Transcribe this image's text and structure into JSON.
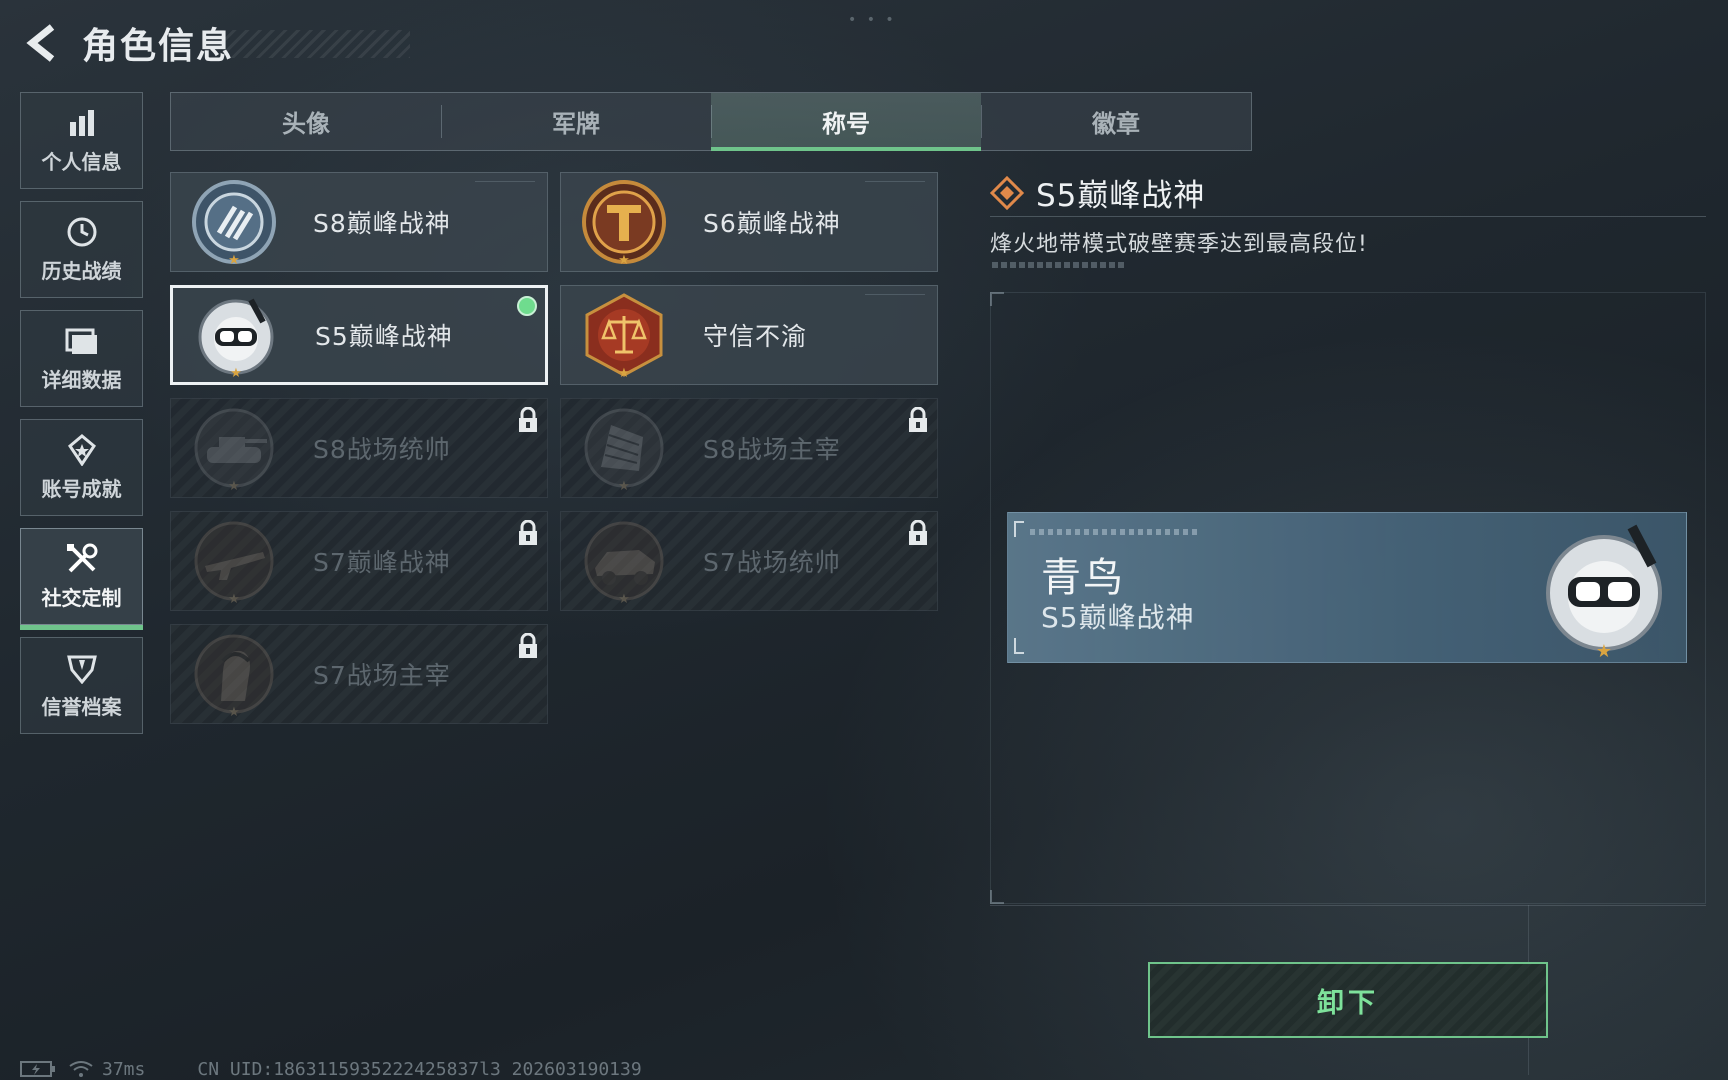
{
  "header": {
    "title": "角色信息"
  },
  "sidebar": {
    "items": [
      {
        "label": "个人信息",
        "icon": "bar-chart-icon",
        "active": false
      },
      {
        "label": "历史战绩",
        "icon": "history-icon",
        "active": false
      },
      {
        "label": "详细数据",
        "icon": "folder-icon",
        "active": false
      },
      {
        "label": "账号成就",
        "icon": "achievement-icon",
        "active": false
      },
      {
        "label": "社交定制",
        "icon": "tools-icon",
        "active": true
      },
      {
        "label": "信誉档案",
        "icon": "credit-shield-icon",
        "active": false
      }
    ]
  },
  "tabs": [
    {
      "label": "头像",
      "active": false
    },
    {
      "label": "军牌",
      "active": false
    },
    {
      "label": "称号",
      "active": true
    },
    {
      "label": "徽章",
      "active": false
    }
  ],
  "titles": [
    {
      "label": "S8巅峰战神",
      "state": "unlocked",
      "icon": "s8-emblem-icon"
    },
    {
      "label": "S6巅峰战神",
      "state": "unlocked",
      "icon": "s6-emblem-icon"
    },
    {
      "label": "S5巅峰战神",
      "state": "equipped",
      "icon": "diver-mask-emblem-icon"
    },
    {
      "label": "守信不渝",
      "state": "unlocked",
      "icon": "scales-emblem-icon"
    },
    {
      "label": "S8战场统帅",
      "state": "locked",
      "icon": "tank-emblem-icon"
    },
    {
      "label": "S8战场主宰",
      "state": "locked",
      "icon": "building-emblem-icon"
    },
    {
      "label": "S7巅峰战神",
      "state": "locked",
      "icon": "rifle-emblem-icon"
    },
    {
      "label": "S7战场统帅",
      "state": "locked",
      "icon": "vehicle-emblem-icon"
    },
    {
      "label": "S7战场主宰",
      "state": "locked",
      "icon": "soldier-emblem-icon"
    }
  ],
  "detail": {
    "name": "S5巅峰战神",
    "description": "烽火地带模式破壁赛季达到最高段位!"
  },
  "nameplate": {
    "player": "青鸟",
    "title": "S5巅峰战神"
  },
  "actions": {
    "unequip_label": "卸下"
  },
  "status": {
    "ping": "37ms",
    "uid": "CN UID:1863115935222425837l3 202603190139"
  },
  "colors": {
    "accent_green": "#6fc48b",
    "equipped_dot": "#6fdc8e",
    "title_diamond": "#e0894a",
    "gold_star": "#d9a441"
  }
}
